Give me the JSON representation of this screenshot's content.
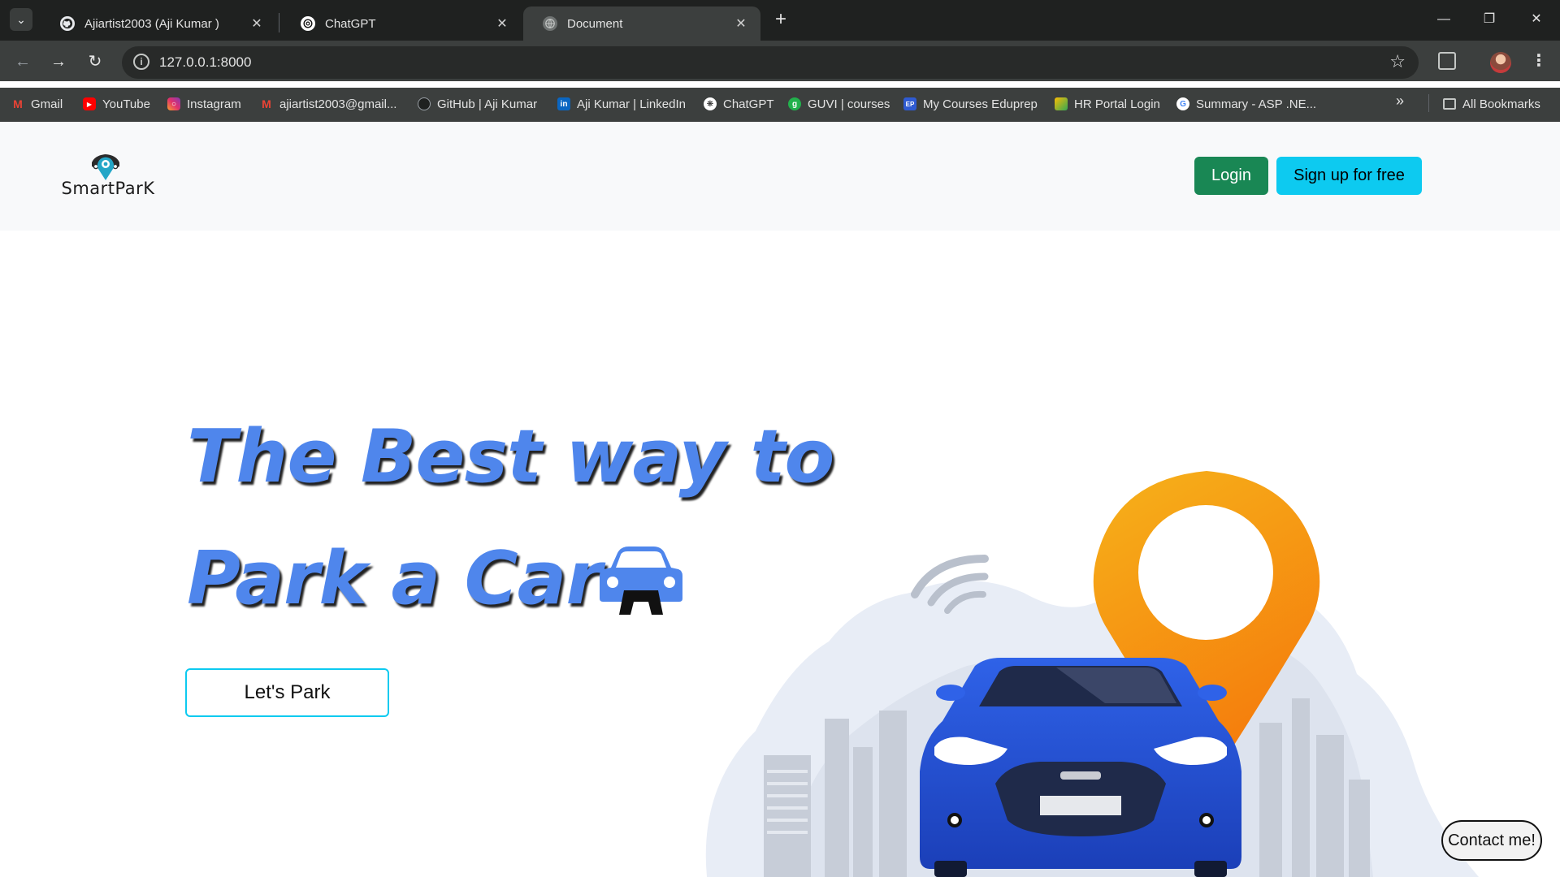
{
  "browser": {
    "tabs": [
      {
        "title": "Ajiartist2003 (Aji Kumar )",
        "icon": "github-icon",
        "active": false
      },
      {
        "title": "ChatGPT",
        "icon": "chatgpt-icon",
        "active": false
      },
      {
        "title": "Document",
        "icon": "globe-icon",
        "active": true
      }
    ],
    "address": "127.0.0.1:8000",
    "bookmarks": [
      {
        "label": "Gmail",
        "icon": "gmail-icon"
      },
      {
        "label": "YouTube",
        "icon": "youtube-icon"
      },
      {
        "label": "Instagram",
        "icon": "instagram-icon"
      },
      {
        "label": "ajiartist2003@gmail...",
        "icon": "gmail-icon"
      },
      {
        "label": "GitHub | Aji Kumar",
        "icon": "github-icon"
      },
      {
        "label": "Aji Kumar | LinkedIn",
        "icon": "linkedin-icon"
      },
      {
        "label": "ChatGPT",
        "icon": "chatgpt-icon"
      },
      {
        "label": "GUVI | courses",
        "icon": "guvi-icon"
      },
      {
        "label": "My Courses Eduprep",
        "icon": "eduprep-icon"
      },
      {
        "label": "HR Portal Login",
        "icon": "hr-portal-icon"
      },
      {
        "label": "Summary - ASP .NE...",
        "icon": "google-icon"
      }
    ],
    "all_bookmarks": "All Bookmarks",
    "colors": {
      "chrome_dark": "#1f2120",
      "chrome": "#3c3f3e"
    }
  },
  "site": {
    "logo_text": "SmartParK",
    "nav": {
      "login": "Login",
      "signup": "Sign up for free"
    },
    "hero": {
      "line1": "The Best way to",
      "line2": "Park a Car",
      "cta": "Let's Park"
    },
    "contact": "Contact me!",
    "colors": {
      "hero_text": "#4f86ec",
      "login": "#198754",
      "signup": "#0dcaf0",
      "pin": "#f7a21b",
      "car": "#1e4fd8"
    }
  }
}
